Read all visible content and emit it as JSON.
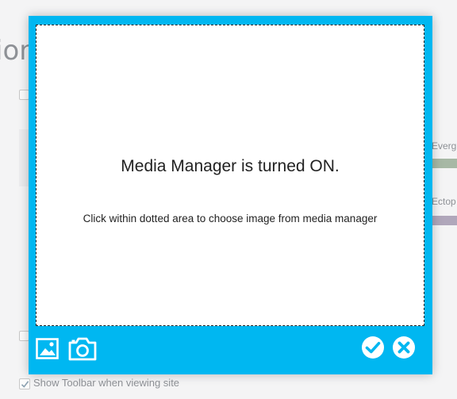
{
  "background": {
    "partial_heading": "ion",
    "side_labels": [
      "Everg",
      "Ectop"
    ],
    "side_bar_colors": [
      "#a7b8a5",
      "#b0a7bb"
    ],
    "toolbar_option_label": "Show Toolbar when viewing site",
    "toolbar_option_checked": true
  },
  "modal": {
    "accent_color": "#00b7f1",
    "title": "Media Manager is turned ON.",
    "hint": "Click within dotted area to choose image from media manager",
    "footer": {
      "left_icons": [
        "image-icon",
        "camera-icon"
      ],
      "right_icons": [
        "confirm-check-icon",
        "cancel-x-icon"
      ]
    }
  }
}
